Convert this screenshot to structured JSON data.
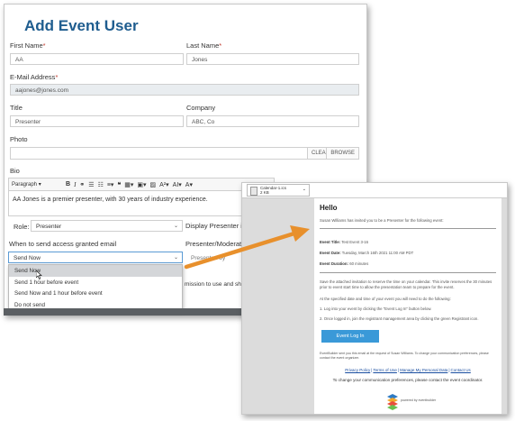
{
  "form": {
    "title": "Add Event User",
    "first_name": {
      "label": "First Name",
      "value": "AA"
    },
    "last_name": {
      "label": "Last Name",
      "value": "Jones"
    },
    "email": {
      "label": "E-Mail Address",
      "value": "aajones@jones.com"
    },
    "title_field": {
      "label": "Title",
      "value": "Presenter"
    },
    "company": {
      "label": "Company",
      "value": "ABC, Co"
    },
    "photo": {
      "label": "Photo",
      "clear": "CLEAR",
      "browse": "BROWSE"
    },
    "bio": {
      "label": "Bio",
      "format_select": "Paragraph",
      "text": "AA Jones is a premier presenter, with 30 years of industry experience."
    },
    "role": {
      "label": "Role:",
      "value": "Presenter"
    },
    "display_presenter_label": "Display Presenter inf",
    "access_email": {
      "label": "When to send access granted email",
      "value": "Send Now",
      "options": [
        "Send Now",
        "Send 1 hour before event",
        "Send Now and 1 hour before event",
        "Do not send"
      ]
    },
    "presenter_moderator_label": "Presenter/Moderato",
    "presenter_by_value": "Presented by",
    "permission_text": "mission to use and share th"
  },
  "email": {
    "attachment": {
      "name": "Calendar-1.ics",
      "size": "2 KB"
    },
    "greeting": "Hello",
    "intro": "Susan Williams has invited you to be a Presenter for the following event:",
    "event_title_label": "Event Title:",
    "event_title_value": "Test Event 3-16",
    "event_date_label": "Event Date:",
    "event_date_value": "Tuesday, March 16th 2021 11:00 AM PDT",
    "event_duration_label": "Event Duration:",
    "event_duration_value": "60 minutes",
    "para1": "Save the attached invitation to reserve the time on your calendar. This invite reserves the 30 minutes prior to event start time to allow the presentation team to prepare for the event.",
    "para2": "At the specified date and time of your event you will need to do the following:",
    "step1": "1. Log into your event by clicking the \"Event Log In\" button below.",
    "step2": "2. Once logged in, join the registrant management area by clicking the green Registrant icon.",
    "login_button": "Event Log In",
    "footer_note": "EventBuilder sent you this email at the request of Susan Williams. To change your communication preferences, please contact the event organizer.",
    "links": [
      "Privacy Policy",
      "Terms of Use",
      "Manage My Personal Data",
      "Contact Us"
    ],
    "pref_line": "To change your communication preferences, please contact the event coordinator.",
    "logo_text": "powered by eventbuilder"
  },
  "colors": {
    "title_blue": "#1f5d8f",
    "arrow_orange": "#e8902c",
    "button_blue": "#3a99d8",
    "required_red": "#c0392b"
  }
}
